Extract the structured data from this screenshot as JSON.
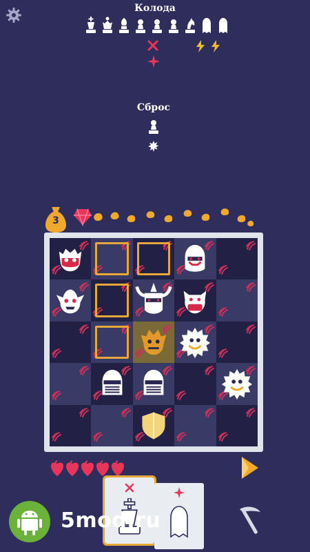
{
  "header": {
    "deck_title": "Колода",
    "discard_title": "Сброс",
    "settings_icon": "gear-icon"
  },
  "deck": {
    "pieces": [
      "king",
      "queen",
      "bishop",
      "pawn",
      "pawn",
      "pawn",
      "knight",
      "ghost",
      "ghost"
    ],
    "markers": [
      "",
      "",
      "",
      "",
      "cross",
      "",
      "",
      "bolt",
      "bolt"
    ],
    "extra_marker": "cross-red"
  },
  "discard": {
    "pieces": [
      "pawn"
    ],
    "markers": [
      "burst"
    ]
  },
  "resources": {
    "bag_count": "3",
    "gem_icon": "red-gem-icon",
    "coin_count_shown": 10
  },
  "board": {
    "size": 5,
    "move_cells": [
      [
        0,
        1
      ],
      [
        0,
        2
      ],
      [
        1,
        1
      ],
      [
        2,
        1
      ]
    ],
    "selected_cell": [
      2,
      2
    ],
    "units": [
      {
        "row": 0,
        "col": 0,
        "kind": "enemy-crab",
        "color": "#d9294a"
      },
      {
        "row": 0,
        "col": 3,
        "kind": "enemy-helmet",
        "color": "#d9294a"
      },
      {
        "row": 1,
        "col": 0,
        "kind": "enemy-goblin",
        "color": "#d9294a"
      },
      {
        "row": 1,
        "col": 2,
        "kind": "enemy-horned",
        "color": "#d9294a"
      },
      {
        "row": 1,
        "col": 3,
        "kind": "enemy-boar",
        "color": "#d9294a"
      },
      {
        "row": 2,
        "col": 2,
        "kind": "enemy-orange",
        "color": "#e19a2a"
      },
      {
        "row": 2,
        "col": 3,
        "kind": "enemy-spiky",
        "color": "#ffffff"
      },
      {
        "row": 3,
        "col": 1,
        "kind": "knight-helm",
        "color": "#ffffff"
      },
      {
        "row": 3,
        "col": 2,
        "kind": "knight-helm",
        "color": "#ffffff"
      },
      {
        "row": 3,
        "col": 4,
        "kind": "enemy-spiky",
        "color": "#ffffff"
      },
      {
        "row": 4,
        "col": 2,
        "kind": "shield",
        "color": "#f3d47a"
      }
    ]
  },
  "lives": {
    "hearts": 5,
    "heart_color": "#e8355a"
  },
  "hand": {
    "cards": [
      {
        "piece": "king",
        "marker": "cross",
        "selected": true
      },
      {
        "piece": "ghost",
        "marker": "cross-red",
        "selected": false
      }
    ]
  },
  "controls": {
    "end_turn_icon": "arrow-right-icon",
    "pickaxe_icon": "pickaxe-icon"
  },
  "watermark": {
    "text": "5mod.ru",
    "logo": "android-icon"
  }
}
